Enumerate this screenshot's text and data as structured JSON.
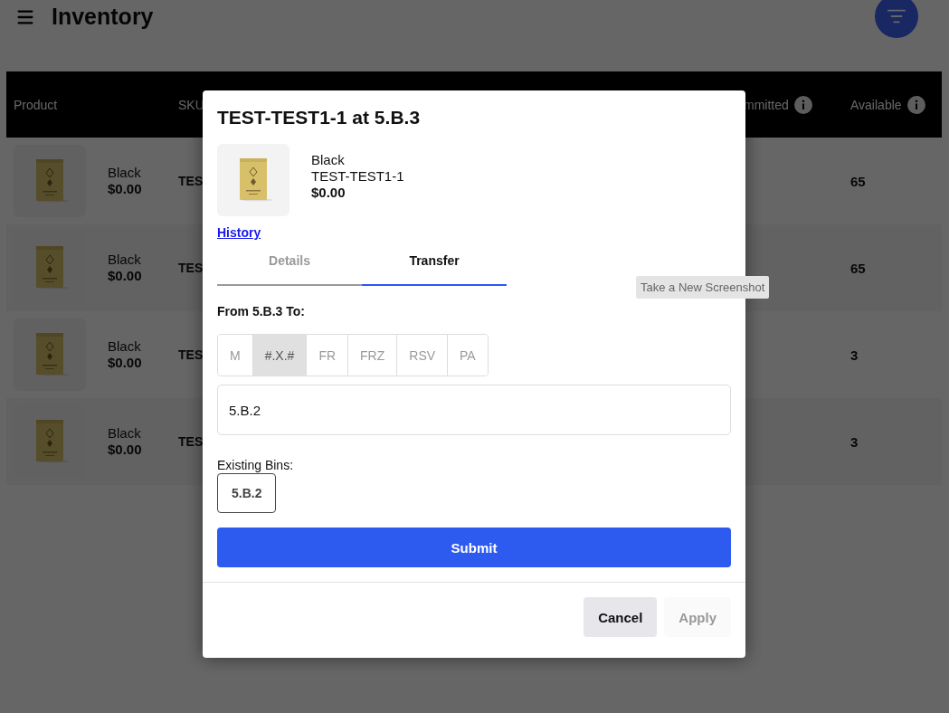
{
  "app_bar": {
    "title": "Inventory"
  },
  "table": {
    "columns": [
      {
        "label": "Product",
        "info": false
      },
      {
        "label": "SKU",
        "info": false
      },
      {
        "label": "mmitted",
        "info": true
      },
      {
        "label": "Available",
        "info": true
      }
    ],
    "rows": [
      {
        "variant": "Black",
        "price": "$0.00",
        "sku": "TES",
        "available": "65"
      },
      {
        "variant": "Black",
        "price": "$0.00",
        "sku": "TES",
        "available": "65"
      },
      {
        "variant": "Black",
        "price": "$0.00",
        "sku": "TES",
        "available": "3"
      },
      {
        "variant": "Black",
        "price": "$0.00",
        "sku": "TES",
        "available": "3"
      }
    ]
  },
  "dialog": {
    "title": "TEST-TEST1-1 at 5.B.3",
    "product": {
      "variant": "Black",
      "sku": "TEST-TEST1-1",
      "price": "$0.00"
    },
    "history_link": "History",
    "tabs": [
      {
        "label": "Details",
        "selected": false
      },
      {
        "label": "Transfer",
        "selected": true
      }
    ],
    "from_label": "From 5.B.3 To:",
    "formats": [
      {
        "label": "M",
        "selected": false
      },
      {
        "label": "#.X.#",
        "selected": true
      },
      {
        "label": "FR",
        "selected": false
      },
      {
        "label": "FRZ",
        "selected": false
      },
      {
        "label": "RSV",
        "selected": false
      },
      {
        "label": "PA",
        "selected": false
      }
    ],
    "location_input": {
      "value": "5.B.2"
    },
    "existing_bins_label": "Existing Bins:",
    "existing_bins": [
      "5.B.2"
    ],
    "submit": "Submit",
    "buttons": [
      {
        "label": "Cancel",
        "disabled": false
      },
      {
        "label": "Apply",
        "disabled": true
      }
    ]
  },
  "tooltip": "Take a New Screenshot"
}
